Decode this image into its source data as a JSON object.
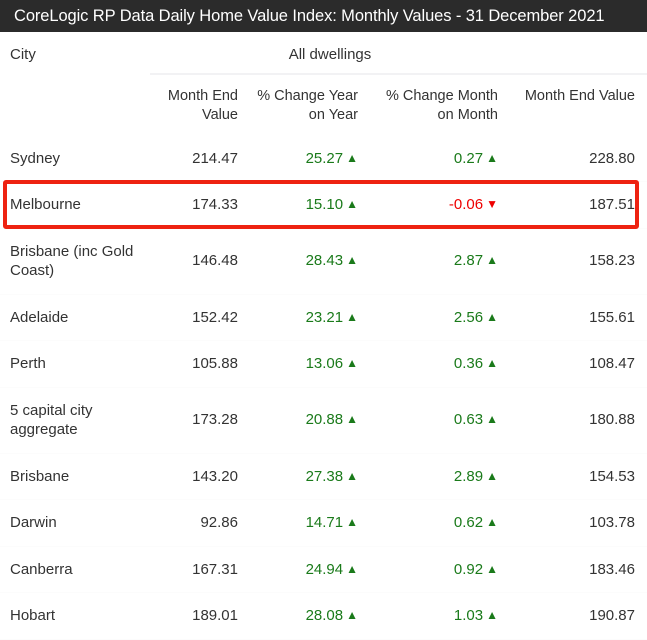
{
  "title": "CoreLogic RP Data Daily Home Value Index: Monthly Values - 31 December 2021",
  "table": {
    "group_headers": {
      "city": "City",
      "all_dwellings": "All dwellings"
    },
    "columns": [
      "City",
      "Month End Value",
      "% Change Year on Year",
      "% Change Month on Month",
      "Month End Value"
    ],
    "sub_headers": {
      "month_end_value_1": "Month\nEnd Value",
      "pct_change_yoy": "% Change\nYear on Year",
      "pct_change_mom": "% Change\nMonth on\nMonth",
      "month_end_value_2": "Month\nEnd Value"
    },
    "highlighted_row": "Melbourne",
    "highlight_color": "#ee2211",
    "up_color": "#1a7a1a",
    "down_color": "#ee0000",
    "up_arrow": "▲",
    "down_arrow": "▼",
    "rows": [
      {
        "city": "Sydney",
        "month_end_value_1": "214.47",
        "pct_change_yoy": "25.27",
        "pct_change_yoy_dir": "up",
        "pct_change_mom": "0.27",
        "pct_change_mom_dir": "up",
        "month_end_value_2": "228.80"
      },
      {
        "city": "Melbourne",
        "month_end_value_1": "174.33",
        "pct_change_yoy": "15.10",
        "pct_change_yoy_dir": "up",
        "pct_change_mom": "-0.06",
        "pct_change_mom_dir": "down",
        "month_end_value_2": "187.51"
      },
      {
        "city": "Brisbane (inc Gold Coast)",
        "month_end_value_1": "146.48",
        "pct_change_yoy": "28.43",
        "pct_change_yoy_dir": "up",
        "pct_change_mom": "2.87",
        "pct_change_mom_dir": "up",
        "month_end_value_2": "158.23"
      },
      {
        "city": "Adelaide",
        "month_end_value_1": "152.42",
        "pct_change_yoy": "23.21",
        "pct_change_yoy_dir": "up",
        "pct_change_mom": "2.56",
        "pct_change_mom_dir": "up",
        "month_end_value_2": "155.61"
      },
      {
        "city": "Perth",
        "month_end_value_1": "105.88",
        "pct_change_yoy": "13.06",
        "pct_change_yoy_dir": "up",
        "pct_change_mom": "0.36",
        "pct_change_mom_dir": "up",
        "month_end_value_2": "108.47"
      },
      {
        "city": "5 capital city aggregate",
        "month_end_value_1": "173.28",
        "pct_change_yoy": "20.88",
        "pct_change_yoy_dir": "up",
        "pct_change_mom": "0.63",
        "pct_change_mom_dir": "up",
        "month_end_value_2": "180.88"
      },
      {
        "city": "Brisbane",
        "month_end_value_1": "143.20",
        "pct_change_yoy": "27.38",
        "pct_change_yoy_dir": "up",
        "pct_change_mom": "2.89",
        "pct_change_mom_dir": "up",
        "month_end_value_2": "154.53"
      },
      {
        "city": "Darwin",
        "month_end_value_1": "92.86",
        "pct_change_yoy": "14.71",
        "pct_change_yoy_dir": "up",
        "pct_change_mom": "0.62",
        "pct_change_mom_dir": "up",
        "month_end_value_2": "103.78"
      },
      {
        "city": "Canberra",
        "month_end_value_1": "167.31",
        "pct_change_yoy": "24.94",
        "pct_change_yoy_dir": "up",
        "pct_change_mom": "0.92",
        "pct_change_mom_dir": "up",
        "month_end_value_2": "183.46"
      },
      {
        "city": "Hobart",
        "month_end_value_1": "189.01",
        "pct_change_yoy": "28.08",
        "pct_change_yoy_dir": "up",
        "pct_change_mom": "1.03",
        "pct_change_mom_dir": "up",
        "month_end_value_2": "190.87"
      }
    ]
  }
}
